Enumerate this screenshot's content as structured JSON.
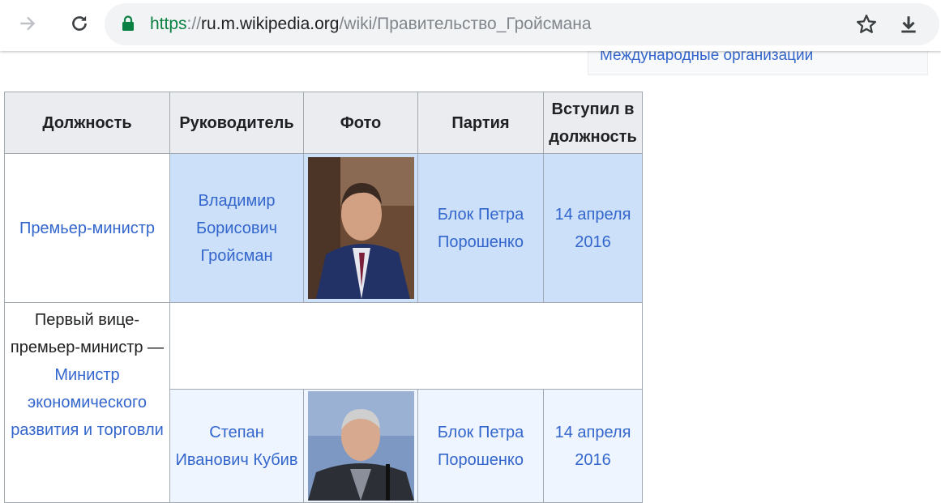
{
  "browser": {
    "url_scheme": "https",
    "url_sep": "://",
    "url_host": "ru.m.wikipedia.org",
    "url_path": "/wiki/Правительство_Гройсмана",
    "icons": [
      "forward-icon",
      "reload-icon",
      "lock-icon",
      "star-icon",
      "download-icon"
    ]
  },
  "infobox": {
    "link": "Международные организации"
  },
  "table": {
    "headers": [
      "Должность",
      "Руководитель",
      "Фото",
      "Партия",
      "Вступил в должность"
    ],
    "rows": [
      {
        "position": "Премьер-министр",
        "leader": "Владимир Борисович Гройсман",
        "party": "Блок Петра Порошенко",
        "date": "14 апреля 2016"
      },
      {
        "position_prefix": "Первый вице-премьер-министр —",
        "position_link": "Министр экономического развития и торговли",
        "leader": "Степан Иванович Кубив",
        "party": "Блок Петра Порошенко",
        "date": "14 апреля 2016"
      }
    ]
  },
  "colors": {
    "link": "#3366cc",
    "secure": "#0b8043",
    "header_bg": "#eaecf0",
    "row1_bg": "#cde0fa",
    "row2_bg": "#eef5fe"
  }
}
